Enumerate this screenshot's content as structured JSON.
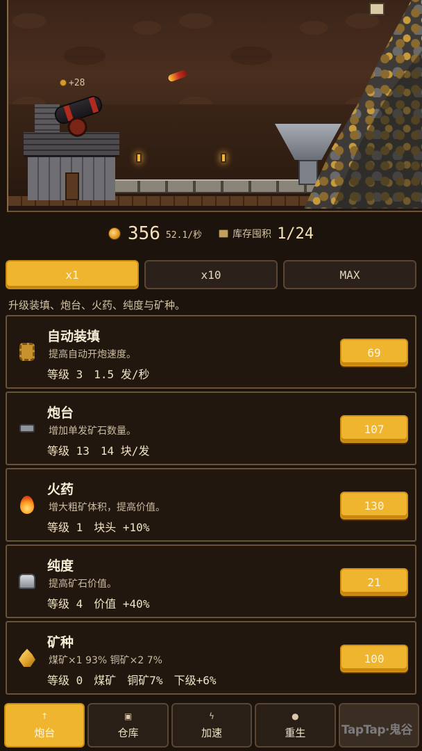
{
  "scene": {
    "coin_gain": "+28"
  },
  "resources": {
    "coins": "356",
    "rate": "52.1/秒",
    "storage_label": "库存囤积",
    "storage_value": "1/24"
  },
  "multipliers": [
    {
      "label": "x1",
      "active": true
    },
    {
      "label": "x10",
      "active": false
    },
    {
      "label": "MAX",
      "active": false
    }
  ],
  "hint": "升级装填、炮台、火药、纯度与矿种。",
  "upgrades": [
    {
      "icon": "gear-icon",
      "title": "自动装填",
      "desc": "提高自动开炮速度。",
      "stat1": "等级 3",
      "stat2": "1.5 发/秒",
      "stat3": "",
      "stat4": "",
      "price": "69"
    },
    {
      "icon": "cannon-icon",
      "title": "炮台",
      "desc": "增加单发矿石数量。",
      "stat1": "等级 13",
      "stat2": "14 块/发",
      "stat3": "",
      "stat4": "",
      "price": "107"
    },
    {
      "icon": "fire-icon",
      "title": "火药",
      "desc": "增大粗矿体积，提高价值。",
      "stat1": "等级 1",
      "stat2": "块头 +10%",
      "stat3": "",
      "stat4": "",
      "price": "130"
    },
    {
      "icon": "weight-icon",
      "title": "纯度",
      "desc": "提高矿石价值。",
      "stat1": "等级 4",
      "stat2": "价值 +40%",
      "stat3": "",
      "stat4": "",
      "price": "21"
    },
    {
      "icon": "crystal-icon",
      "title": "矿种",
      "desc": "煤矿×1 93%  铜矿×2 7%",
      "stat1": "等级 0",
      "stat2": "煤矿",
      "stat3": "铜矿7%",
      "stat4": "下级+6%",
      "price": "100"
    }
  ],
  "nav": [
    {
      "label": "炮台",
      "icon": "↑",
      "active": true
    },
    {
      "label": "仓库",
      "icon": "▣",
      "active": false
    },
    {
      "label": "加速",
      "icon": "ϟ",
      "active": false
    },
    {
      "label": "重生",
      "icon": "●",
      "active": false
    },
    {
      "label": "",
      "icon": "",
      "active": false
    }
  ],
  "watermark": "TapTap·鬼谷"
}
